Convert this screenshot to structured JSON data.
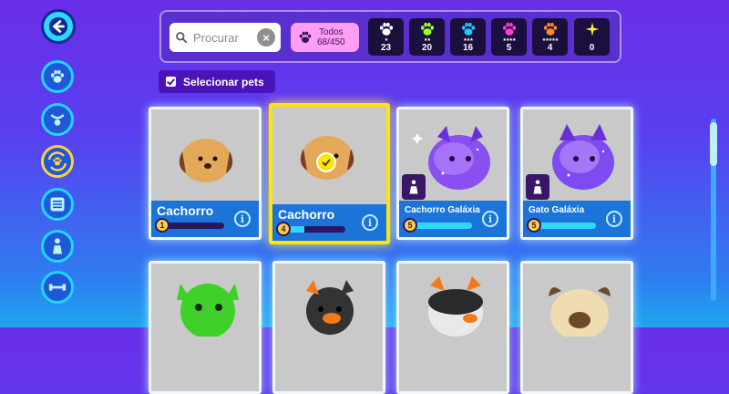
{
  "search": {
    "placeholder": "Procurar"
  },
  "filter_all": {
    "label": "Todos",
    "count": "68/450"
  },
  "rarity_filters": [
    {
      "color": "#ffffff",
      "stars": "★",
      "count": "23"
    },
    {
      "color": "#9bff2e",
      "stars": "★★",
      "count": "20"
    },
    {
      "color": "#22c9ff",
      "stars": "★★★",
      "count": "16"
    },
    {
      "color": "#ff3fd2",
      "stars": "★★★★",
      "count": "5"
    },
    {
      "color": "#ff8a1f",
      "stars": "★★★★★",
      "count": "4"
    },
    {
      "color": "#ffe94a",
      "stars": "",
      "count": "0"
    }
  ],
  "select_button": {
    "label": "Selecionar pets"
  },
  "pets": [
    {
      "name": "Cachorro",
      "level": "1",
      "progress": 0.0,
      "selected": false,
      "type": "dog"
    },
    {
      "name": "Cachorro",
      "level": "4",
      "progress": 0.3,
      "selected": true,
      "type": "dog"
    },
    {
      "name": "Cachorro Galáxia",
      "level": "5",
      "progress": 1.0,
      "selected": false,
      "type": "galaxy-dog"
    },
    {
      "name": "Gato Galáxia",
      "level": "5",
      "progress": 1.0,
      "selected": false,
      "type": "galaxy-cat"
    }
  ],
  "sidebar": [
    {
      "icon": "paw-icon"
    },
    {
      "icon": "collar-icon"
    },
    {
      "icon": "paw-cycle-icon"
    },
    {
      "icon": "list-icon"
    },
    {
      "icon": "character-icon"
    },
    {
      "icon": "dumbbell-icon"
    }
  ]
}
